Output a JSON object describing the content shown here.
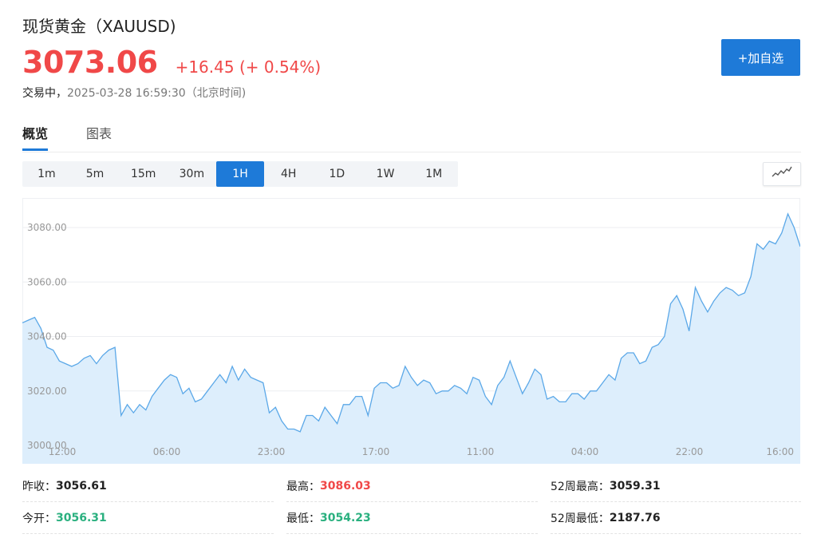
{
  "header": {
    "title": "现货黄金（XAUUSD)",
    "price": "3073.06",
    "change": "+16.45 (+ 0.54%)",
    "status": "交易中，",
    "timestamp": "2025-03-28 16:59:30（北京时间)",
    "add_button": "+加自选"
  },
  "tabs": [
    {
      "label": "概览",
      "active": true
    },
    {
      "label": "图表",
      "active": false
    }
  ],
  "intervals": [
    {
      "label": "1m"
    },
    {
      "label": "5m"
    },
    {
      "label": "15m"
    },
    {
      "label": "30m"
    },
    {
      "label": "1H",
      "active": true
    },
    {
      "label": "4H"
    },
    {
      "label": "1D"
    },
    {
      "label": "1W"
    },
    {
      "label": "1M"
    }
  ],
  "chart_type_icon": "line-chart-icon",
  "colors": {
    "up": "#f04848",
    "down": "#2ab07f",
    "accent": "#1e7ad8",
    "line": "#5ba8e8",
    "fill": "#ddeefc"
  },
  "chart_data": {
    "type": "area",
    "x_tick_labels": [
      "12:00",
      "06:00",
      "23:00",
      "17:00",
      "11:00",
      "04:00",
      "22:00",
      "16:00"
    ],
    "y_tick_labels": [
      "3000.00",
      "3020.00",
      "3040.00",
      "3060.00",
      "3080.00"
    ],
    "ylim": [
      3000,
      3088
    ],
    "grid": true,
    "values": [
      3045,
      3046,
      3047,
      3043,
      3036,
      3035,
      3031,
      3030,
      3029,
      3030,
      3032,
      3033,
      3030,
      3033,
      3035,
      3036,
      3011,
      3015,
      3012,
      3015,
      3013,
      3018,
      3021,
      3024,
      3026,
      3025,
      3019,
      3021,
      3016,
      3017,
      3020,
      3023,
      3026,
      3023,
      3029,
      3024,
      3028,
      3025,
      3024,
      3023,
      3012,
      3014,
      3009,
      3006,
      3006,
      3005,
      3011,
      3011,
      3009,
      3014,
      3011,
      3008,
      3015,
      3015,
      3018,
      3018,
      3011,
      3021,
      3023,
      3023,
      3021,
      3022,
      3029,
      3025,
      3022,
      3024,
      3023,
      3019,
      3020,
      3020,
      3022,
      3021,
      3019,
      3025,
      3024,
      3018,
      3015,
      3022,
      3025,
      3031,
      3025,
      3019,
      3023,
      3028,
      3026,
      3017,
      3018,
      3016,
      3016,
      3019,
      3019,
      3017,
      3020,
      3020,
      3023,
      3026,
      3024,
      3032,
      3034,
      3034,
      3030,
      3031,
      3036,
      3037,
      3040,
      3052,
      3055,
      3050,
      3042,
      3058,
      3053,
      3049,
      3053,
      3056,
      3058,
      3057,
      3055,
      3056,
      3062,
      3074,
      3072,
      3075,
      3074,
      3078,
      3085,
      3080,
      3073
    ]
  },
  "stats": [
    [
      {
        "label": "昨收：",
        "value": "3056.61",
        "color": "dark"
      },
      {
        "label": "最高：",
        "value": "3086.03",
        "color": "red"
      },
      {
        "label": "52周最高：",
        "value": "3059.31",
        "color": "dark"
      }
    ],
    [
      {
        "label": "今开：",
        "value": "3056.31",
        "color": "green"
      },
      {
        "label": "最低：",
        "value": "3054.23",
        "color": "green"
      },
      {
        "label": "52周最低：",
        "value": "2187.76",
        "color": "dark"
      }
    ]
  ]
}
